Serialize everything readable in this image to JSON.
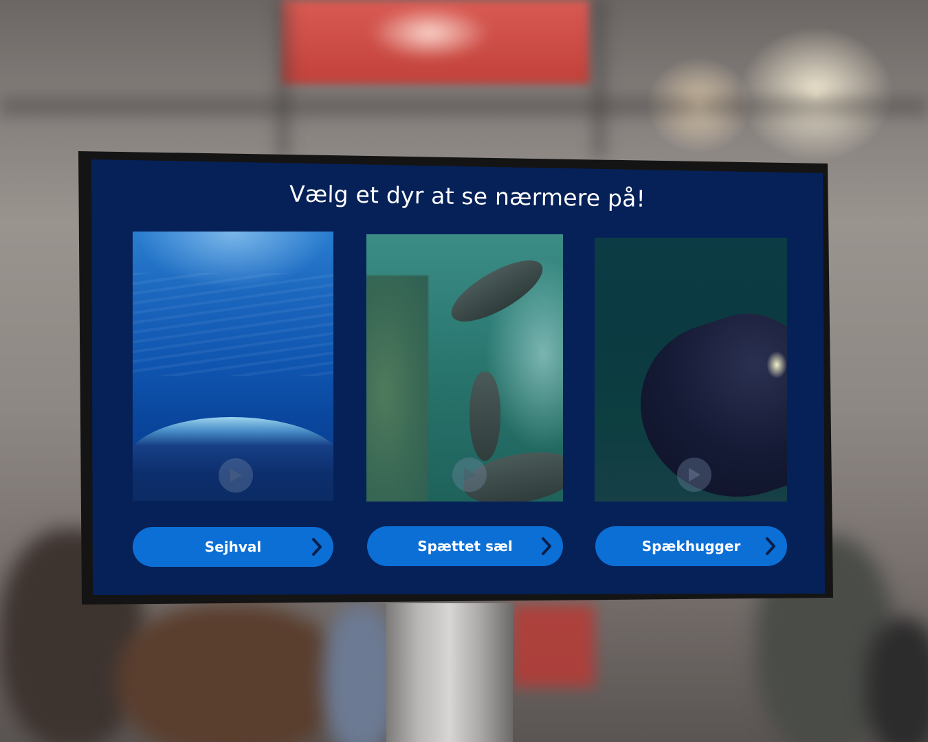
{
  "screen": {
    "title": "Vælg et dyr at se nærmere på!"
  },
  "animals": [
    {
      "label": "Sejhval",
      "media_icon": "play-icon",
      "button_icon": "chevron-right-icon"
    },
    {
      "label": "Spættet sæl",
      "media_icon": "play-icon",
      "button_icon": "chevron-right-icon"
    },
    {
      "label": "Spækhugger",
      "media_icon": "play-icon",
      "button_icon": "chevron-right-icon"
    }
  ],
  "colors": {
    "screen_background": "#062158",
    "button_background": "#0c6fd6",
    "text": "#ffffff"
  }
}
